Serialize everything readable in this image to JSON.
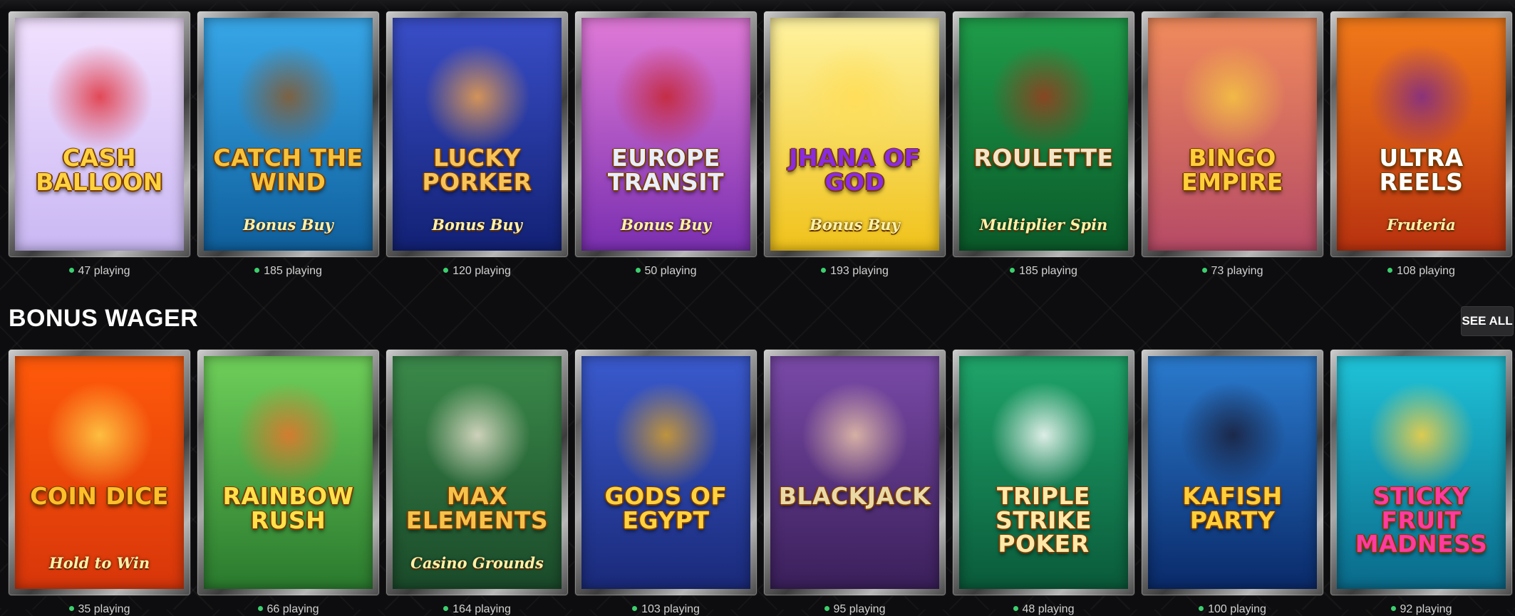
{
  "top_row": {
    "games": [
      {
        "title": "Cash Balloon",
        "subtitle": "",
        "playing": "47 playing",
        "bg": [
          "#f3e1ff",
          "#c9b8f3"
        ],
        "glow": "#e0303a",
        "title_color": "#ffd23f"
      },
      {
        "title": "Catch the Wind",
        "subtitle": "Bonus Buy",
        "playing": "185 playing",
        "bg": [
          "#38a7e8",
          "#0f5f9c"
        ],
        "glow": "#8a5a2b",
        "title_color": "#f6c23a"
      },
      {
        "title": "Lucky Porker",
        "subtitle": "Bonus Buy",
        "playing": "120 playing",
        "bg": [
          "#3a4ec8",
          "#122174"
        ],
        "glow": "#f0a24a",
        "title_color": "#f7c45a"
      },
      {
        "title": "Europe Transit",
        "subtitle": "Bonus Buy",
        "playing": "50 playing",
        "bg": [
          "#e07ad7",
          "#7a2fb0"
        ],
        "glow": "#c6242e",
        "title_color": "#e8eefc"
      },
      {
        "title": "Jhana of God",
        "subtitle": "Bonus Buy",
        "playing": "193 playing",
        "bg": [
          "#fff3a0",
          "#f0c21a"
        ],
        "glow": "#ffdd55",
        "title_color": "#8a2be2"
      },
      {
        "title": "Roulette",
        "subtitle": "Multiplier Spin",
        "playing": "185 playing",
        "bg": [
          "#1f9d4a",
          "#0a5a2a"
        ],
        "glow": "#9b3b1e",
        "title_color": "#f2e6c9"
      },
      {
        "title": "Bingo Empire",
        "subtitle": "",
        "playing": "73 playing",
        "bg": [
          "#f08b5c",
          "#b54a66"
        ],
        "glow": "#f5c542",
        "title_color": "#ffcf3a"
      },
      {
        "title": "Ultra Reels",
        "subtitle": "Fruteria",
        "playing": "108 playing",
        "bg": [
          "#f27a1a",
          "#b8320f"
        ],
        "glow": "#7b2a8c",
        "title_color": "#ffffff"
      }
    ]
  },
  "bonus_wager": {
    "title": "BONUS WAGER",
    "see_all_label": "SEE ALL",
    "games": [
      {
        "title": "Coin Dice",
        "subtitle": "Hold to Win",
        "playing": "35 playing",
        "bg": [
          "#ff5a0a",
          "#d8360a"
        ],
        "glow": "#ffd24a",
        "title_color": "#ffbf2a"
      },
      {
        "title": "Rainbow Rush",
        "subtitle": "",
        "playing": "66 playing",
        "bg": [
          "#6fcf5a",
          "#2a7a2e"
        ],
        "glow": "#e8732b",
        "title_color": "#ffe14a"
      },
      {
        "title": "Max Elements",
        "subtitle": "Casino Grounds",
        "playing": "164 playing",
        "bg": [
          "#3b8a4a",
          "#1a4a2a"
        ],
        "glow": "#e9e2cf",
        "title_color": "#f7c24a"
      },
      {
        "title": "Gods of Egypt",
        "subtitle": "",
        "playing": "103 playing",
        "bg": [
          "#3a5acd",
          "#1a2a7a"
        ],
        "glow": "#d8a02a",
        "title_color": "#ffd23f"
      },
      {
        "title": "Blackjack",
        "subtitle": "",
        "playing": "95 playing",
        "bg": [
          "#7a4aa8",
          "#3a1f5a"
        ],
        "glow": "#e9c4a8",
        "title_color": "#e9d9a8"
      },
      {
        "title": "Triple Strike Poker",
        "subtitle": "",
        "playing": "48 playing",
        "bg": [
          "#1fa56a",
          "#0a5a3a"
        ],
        "glow": "#ffffff",
        "title_color": "#ffe9a8"
      },
      {
        "title": "Kafish Party",
        "subtitle": "",
        "playing": "100 playing",
        "bg": [
          "#2a7acd",
          "#0a2a6a"
        ],
        "glow": "#1a1f3a",
        "title_color": "#ffcf3a"
      },
      {
        "title": "Sticky Fruit Madness",
        "subtitle": "",
        "playing": "92 playing",
        "bg": [
          "#1fc3d8",
          "#0a6a8a"
        ],
        "glow": "#ffd23f",
        "title_color": "#ff3aa0"
      }
    ]
  }
}
